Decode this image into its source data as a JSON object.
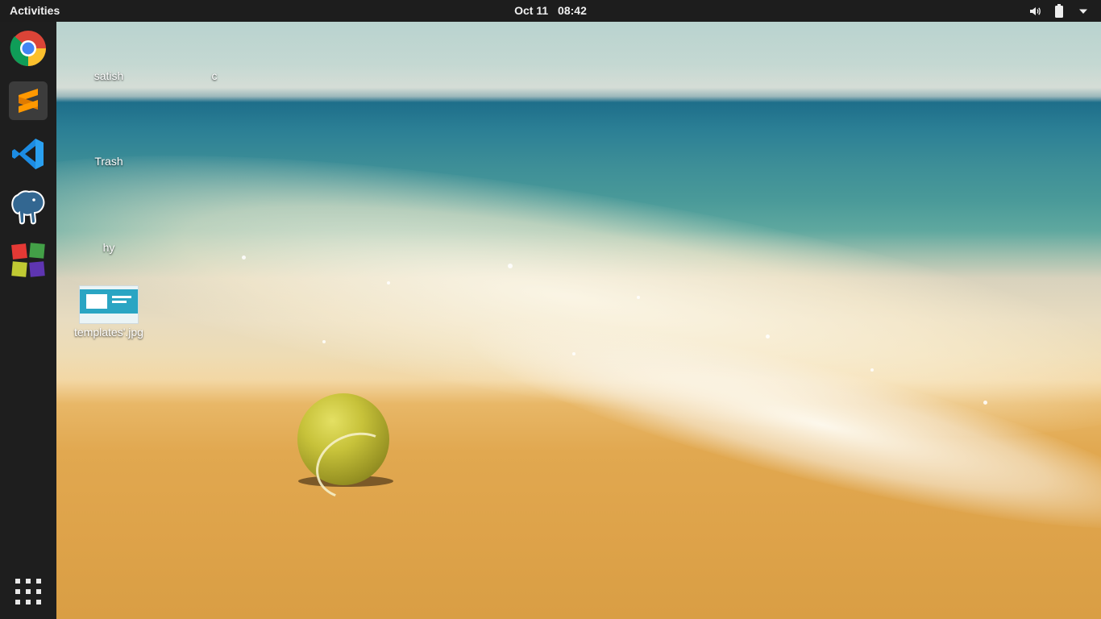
{
  "topbar": {
    "activities_label": "Activities",
    "date": "Oct 11",
    "time": "08:42",
    "tray": [
      "volume-icon",
      "battery-icon",
      "system-menu-arrow-icon"
    ]
  },
  "dock": {
    "items": [
      {
        "name": "Google Chrome",
        "icon": "chrome-icon",
        "active": false
      },
      {
        "name": "Sublime Text",
        "icon": "sublime-text-icon",
        "active": true
      },
      {
        "name": "Visual Studio Code",
        "icon": "vscode-icon",
        "active": false
      },
      {
        "name": "pgAdmin",
        "icon": "postgresql-elephant-icon",
        "active": false
      },
      {
        "name": "Software",
        "icon": "colored-squares-icon",
        "active": false
      }
    ],
    "show_apps_icon": "show-applications-grid-icon"
  },
  "desktop": {
    "icons": [
      {
        "label": "satish"
      },
      {
        "label": "c"
      },
      {
        "label": "Trash"
      },
      {
        "label": "hy"
      },
      {
        "label": "templates'.jpg"
      }
    ],
    "wallpaper": "beach-tennis-ball"
  },
  "colors": {
    "topbar_bg": "#1d1d1d",
    "dock_bg": "#1e1e1e",
    "dock_active_bg": "#3c3c3c"
  }
}
